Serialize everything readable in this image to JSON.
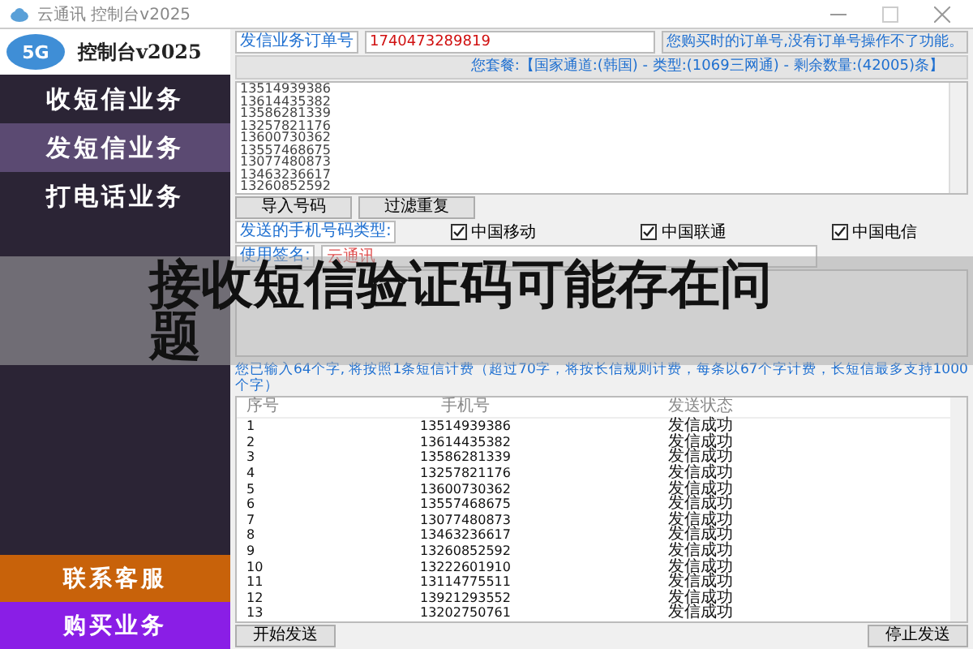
{
  "window": {
    "title": "云通讯 控制台v2025"
  },
  "sidebar": {
    "logo_badge": "5G",
    "logo_title": "控制台v2025",
    "items": [
      {
        "label": "收短信业务",
        "selected": false
      },
      {
        "label": "发短信业务",
        "selected": true
      },
      {
        "label": "打电话业务",
        "selected": false
      }
    ],
    "bottom_buttons": [
      {
        "label": "联系客服",
        "color": "#c8620a"
      },
      {
        "label": "购买业务",
        "color": "#8a1ee6"
      }
    ]
  },
  "order": {
    "label": "发信业务订单号",
    "value": "1740473289819",
    "hint": "您购买时的订单号,没有订单号操作不了功能。"
  },
  "package_info": "您套餐:【国家通道:(韩国) - 类型:(1069三网通) - 剩余数量:(42005)条】",
  "numbers": [
    "13514939386",
    "13614435382",
    "13586281339",
    "13257821176",
    "13600730362",
    "13557468675",
    "13077480873",
    "13463236617",
    "13260852592"
  ],
  "number_buttons": [
    "导入号码",
    "过滤重复"
  ],
  "carrier_label": "发送的手机号码类型:",
  "carriers": [
    {
      "label": "中国移动",
      "checked": true
    },
    {
      "label": "中国联通",
      "checked": true
    },
    {
      "label": "中国电信",
      "checked": true
    }
  ],
  "signature": {
    "label": "使用签名:",
    "value": "云通讯"
  },
  "count_text": "您已输入64个字, 将按照1条短信计费（超过70字，将按长信规则计费，每条以67个字计费，长短信最多支持1000个字）",
  "table": {
    "columns": [
      "序号",
      "手机号",
      "发送状态"
    ],
    "rows": [
      [
        "1",
        "13514939386",
        "发信成功"
      ],
      [
        "2",
        "13614435382",
        "发信成功"
      ],
      [
        "3",
        "13586281339",
        "发信成功"
      ],
      [
        "4",
        "13257821176",
        "发信成功"
      ],
      [
        "5",
        "13600730362",
        "发信成功"
      ],
      [
        "6",
        "13557468675",
        "发信成功"
      ],
      [
        "7",
        "13077480873",
        "发信成功"
      ],
      [
        "8",
        "13463236617",
        "发信成功"
      ],
      [
        "9",
        "13260852592",
        "发信成功"
      ],
      [
        "10",
        "13222601910",
        "发信成功"
      ],
      [
        "11",
        "13114775511",
        "发信成功"
      ],
      [
        "12",
        "13921293552",
        "发信成功"
      ],
      [
        "13",
        "13202750761",
        "发信成功"
      ]
    ]
  },
  "send_buttons": [
    "开始发送",
    "停止发送"
  ],
  "overlay_title": "接收短信验证码可能存在问题"
}
